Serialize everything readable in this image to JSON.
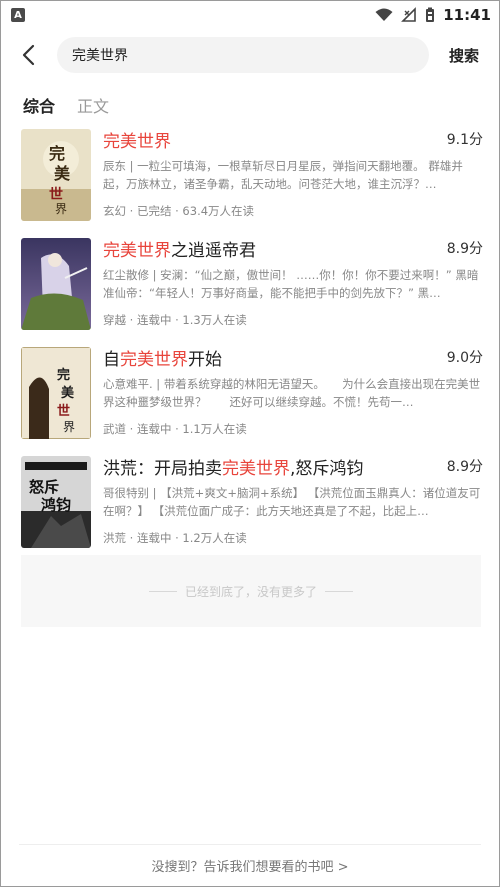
{
  "status_bar": {
    "time": "11:41",
    "app_icon": "A"
  },
  "search": {
    "query": "完美世界",
    "button_label": "搜索"
  },
  "tabs": [
    {
      "label": "综合",
      "active": true
    },
    {
      "label": "正文",
      "active": false
    }
  ],
  "results": [
    {
      "title_pre": "",
      "title_hl": "完美世界",
      "title_post": "",
      "score": "9.1分",
      "desc": "辰东 | 一粒尘可填海，一根草斩尽日月星辰，弹指间天翻地覆。 群雄并起，万族林立，诸圣争霸，乱天动地。问苍茫大地，谁主沉浮？…",
      "meta": "玄幻 · 已完结 · 63.4万人在读"
    },
    {
      "title_pre": "",
      "title_hl": "完美世界",
      "title_post": "之逍遥帝君",
      "score": "8.9分",
      "desc": "红尘散修 | 安澜：“仙之巅，傲世间！ ……你！你！你不要过来啊！” 黑暗准仙帝：“年轻人！万事好商量，能不能把手中的剑先放下？” 黑…",
      "meta": "穿越 · 连载中 · 1.3万人在读"
    },
    {
      "title_pre": "自",
      "title_hl": "完美世界",
      "title_post": "开始",
      "score": "9.0分",
      "desc": "心意难平. | 带着系统穿越的林阳无语望天。　　为什么会直接出现在完美世界这种噩梦级世界？　　还好可以继续穿越。不慌！先苟一…",
      "meta": "武道 · 连载中 · 1.1万人在读"
    },
    {
      "title_pre": "洪荒：开局拍卖",
      "title_hl": "完美世界",
      "title_post": ",怒斥鸿钧",
      "score": "8.9分",
      "desc": "哥很特别 | 【洪荒+爽文+脑洞+系统】 【洪荒位面玉鼎真人：诸位道友可在啊？】 【洪荒位面广成子：此方天地还真是了不起，比起上…",
      "meta": "洪荒 · 连载中 · 1.2万人在读"
    }
  ],
  "end_text": "已经到底了，没有更多了",
  "footer": "没搜到？告诉我们想要看的书吧 >"
}
